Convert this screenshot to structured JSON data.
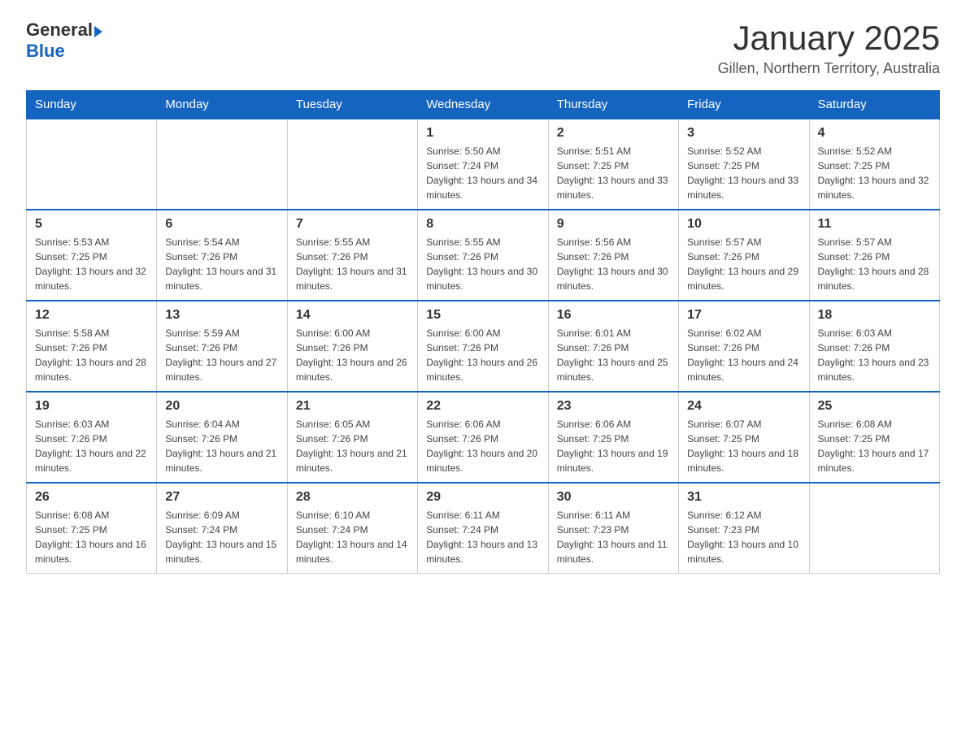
{
  "header": {
    "logo_general": "General",
    "logo_blue": "Blue",
    "title": "January 2025",
    "subtitle": "Gillen, Northern Territory, Australia"
  },
  "days_of_week": [
    "Sunday",
    "Monday",
    "Tuesday",
    "Wednesday",
    "Thursday",
    "Friday",
    "Saturday"
  ],
  "weeks": [
    [
      {
        "day": "",
        "info": ""
      },
      {
        "day": "",
        "info": ""
      },
      {
        "day": "",
        "info": ""
      },
      {
        "day": "1",
        "info": "Sunrise: 5:50 AM\nSunset: 7:24 PM\nDaylight: 13 hours and 34 minutes."
      },
      {
        "day": "2",
        "info": "Sunrise: 5:51 AM\nSunset: 7:25 PM\nDaylight: 13 hours and 33 minutes."
      },
      {
        "day": "3",
        "info": "Sunrise: 5:52 AM\nSunset: 7:25 PM\nDaylight: 13 hours and 33 minutes."
      },
      {
        "day": "4",
        "info": "Sunrise: 5:52 AM\nSunset: 7:25 PM\nDaylight: 13 hours and 32 minutes."
      }
    ],
    [
      {
        "day": "5",
        "info": "Sunrise: 5:53 AM\nSunset: 7:25 PM\nDaylight: 13 hours and 32 minutes."
      },
      {
        "day": "6",
        "info": "Sunrise: 5:54 AM\nSunset: 7:26 PM\nDaylight: 13 hours and 31 minutes."
      },
      {
        "day": "7",
        "info": "Sunrise: 5:55 AM\nSunset: 7:26 PM\nDaylight: 13 hours and 31 minutes."
      },
      {
        "day": "8",
        "info": "Sunrise: 5:55 AM\nSunset: 7:26 PM\nDaylight: 13 hours and 30 minutes."
      },
      {
        "day": "9",
        "info": "Sunrise: 5:56 AM\nSunset: 7:26 PM\nDaylight: 13 hours and 30 minutes."
      },
      {
        "day": "10",
        "info": "Sunrise: 5:57 AM\nSunset: 7:26 PM\nDaylight: 13 hours and 29 minutes."
      },
      {
        "day": "11",
        "info": "Sunrise: 5:57 AM\nSunset: 7:26 PM\nDaylight: 13 hours and 28 minutes."
      }
    ],
    [
      {
        "day": "12",
        "info": "Sunrise: 5:58 AM\nSunset: 7:26 PM\nDaylight: 13 hours and 28 minutes."
      },
      {
        "day": "13",
        "info": "Sunrise: 5:59 AM\nSunset: 7:26 PM\nDaylight: 13 hours and 27 minutes."
      },
      {
        "day": "14",
        "info": "Sunrise: 6:00 AM\nSunset: 7:26 PM\nDaylight: 13 hours and 26 minutes."
      },
      {
        "day": "15",
        "info": "Sunrise: 6:00 AM\nSunset: 7:26 PM\nDaylight: 13 hours and 26 minutes."
      },
      {
        "day": "16",
        "info": "Sunrise: 6:01 AM\nSunset: 7:26 PM\nDaylight: 13 hours and 25 minutes."
      },
      {
        "day": "17",
        "info": "Sunrise: 6:02 AM\nSunset: 7:26 PM\nDaylight: 13 hours and 24 minutes."
      },
      {
        "day": "18",
        "info": "Sunrise: 6:03 AM\nSunset: 7:26 PM\nDaylight: 13 hours and 23 minutes."
      }
    ],
    [
      {
        "day": "19",
        "info": "Sunrise: 6:03 AM\nSunset: 7:26 PM\nDaylight: 13 hours and 22 minutes."
      },
      {
        "day": "20",
        "info": "Sunrise: 6:04 AM\nSunset: 7:26 PM\nDaylight: 13 hours and 21 minutes."
      },
      {
        "day": "21",
        "info": "Sunrise: 6:05 AM\nSunset: 7:26 PM\nDaylight: 13 hours and 21 minutes."
      },
      {
        "day": "22",
        "info": "Sunrise: 6:06 AM\nSunset: 7:26 PM\nDaylight: 13 hours and 20 minutes."
      },
      {
        "day": "23",
        "info": "Sunrise: 6:06 AM\nSunset: 7:25 PM\nDaylight: 13 hours and 19 minutes."
      },
      {
        "day": "24",
        "info": "Sunrise: 6:07 AM\nSunset: 7:25 PM\nDaylight: 13 hours and 18 minutes."
      },
      {
        "day": "25",
        "info": "Sunrise: 6:08 AM\nSunset: 7:25 PM\nDaylight: 13 hours and 17 minutes."
      }
    ],
    [
      {
        "day": "26",
        "info": "Sunrise: 6:08 AM\nSunset: 7:25 PM\nDaylight: 13 hours and 16 minutes."
      },
      {
        "day": "27",
        "info": "Sunrise: 6:09 AM\nSunset: 7:24 PM\nDaylight: 13 hours and 15 minutes."
      },
      {
        "day": "28",
        "info": "Sunrise: 6:10 AM\nSunset: 7:24 PM\nDaylight: 13 hours and 14 minutes."
      },
      {
        "day": "29",
        "info": "Sunrise: 6:11 AM\nSunset: 7:24 PM\nDaylight: 13 hours and 13 minutes."
      },
      {
        "day": "30",
        "info": "Sunrise: 6:11 AM\nSunset: 7:23 PM\nDaylight: 13 hours and 11 minutes."
      },
      {
        "day": "31",
        "info": "Sunrise: 6:12 AM\nSunset: 7:23 PM\nDaylight: 13 hours and 10 minutes."
      },
      {
        "day": "",
        "info": ""
      }
    ]
  ]
}
